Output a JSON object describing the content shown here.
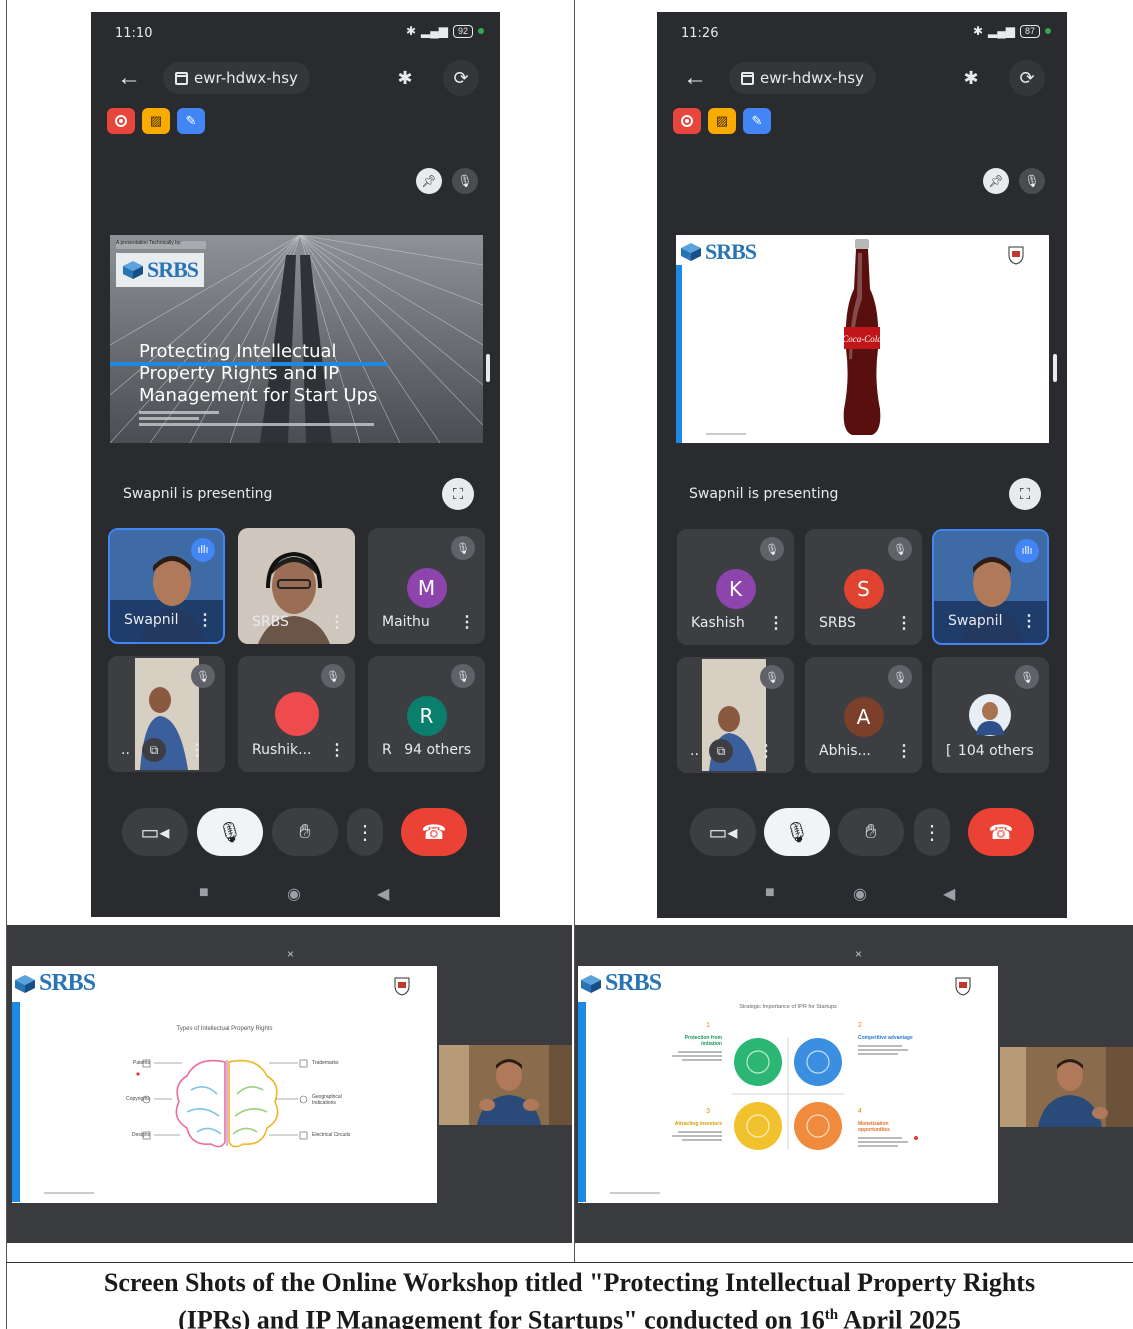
{
  "caption": {
    "line1": "Screen Shots of the Online Workshop titled \"Protecting Intellectual Property Rights",
    "line2_pre": "(IPRs) and IP Management for Startups\" conducted on 16",
    "line2_sup": "th",
    "line2_post": " April 2025"
  },
  "phone_left": {
    "time": "11:10",
    "battery": "92",
    "meeting_code": "ewr-hdwx-hsy",
    "presenting_text": "Swapnil is presenting",
    "slide": {
      "kicker": "A presentation Technically by:",
      "logo_text": "SRBS",
      "title_line1": "Protecting Intellectual",
      "title_line2": "Property Rights and IP",
      "title_line3": "Management for Start Ups"
    },
    "tiles": [
      {
        "name": "Swapnil"
      },
      {
        "name": "SRBS"
      },
      {
        "name": "Maithu",
        "initial": "M"
      },
      {
        "name": ".."
      },
      {
        "name": "Rushik..."
      },
      {
        "name": "R",
        "initial": "R",
        "others": "94 others"
      }
    ]
  },
  "phone_right": {
    "time": "11:26",
    "battery": "87",
    "meeting_code": "ewr-hdwx-hsy",
    "presenting_text": "Swapnil is presenting",
    "slide": {
      "logo_text": "SRBS",
      "bottle_label": "Coca-Cola"
    },
    "tiles": [
      {
        "name": "Kashish",
        "initial": "K"
      },
      {
        "name": "SRBS",
        "initial": "S"
      },
      {
        "name": "Swapnil"
      },
      {
        "name": ".."
      },
      {
        "name": "Abhis...",
        "initial": "A"
      },
      {
        "name": "[",
        "others": "104 others"
      }
    ]
  },
  "laptop_left": {
    "close": "×",
    "logo_text": "SRBS",
    "slide_title": "Types of Intellectual Property Rights",
    "left_items": [
      "Patents",
      "Copyrights",
      "Designs"
    ],
    "right_items": [
      "Trademarks",
      "Geographical Indications",
      "Electrical Circuits"
    ]
  },
  "laptop_right": {
    "close": "×",
    "logo_text": "SRBS",
    "slide_title": "Strategic Importance of IPR for Startups",
    "numbers": [
      "1",
      "2",
      "3",
      "4"
    ],
    "headings": [
      "Protection from imitation",
      "Competitive advantage",
      "Attracting investors",
      "Monetization opportunities"
    ]
  },
  "colors": {
    "phone_bg": "#2a2b2e",
    "accent_blue": "#4285f4",
    "end_call_red": "#ea4335",
    "srbs_blue": "#2874b5"
  }
}
